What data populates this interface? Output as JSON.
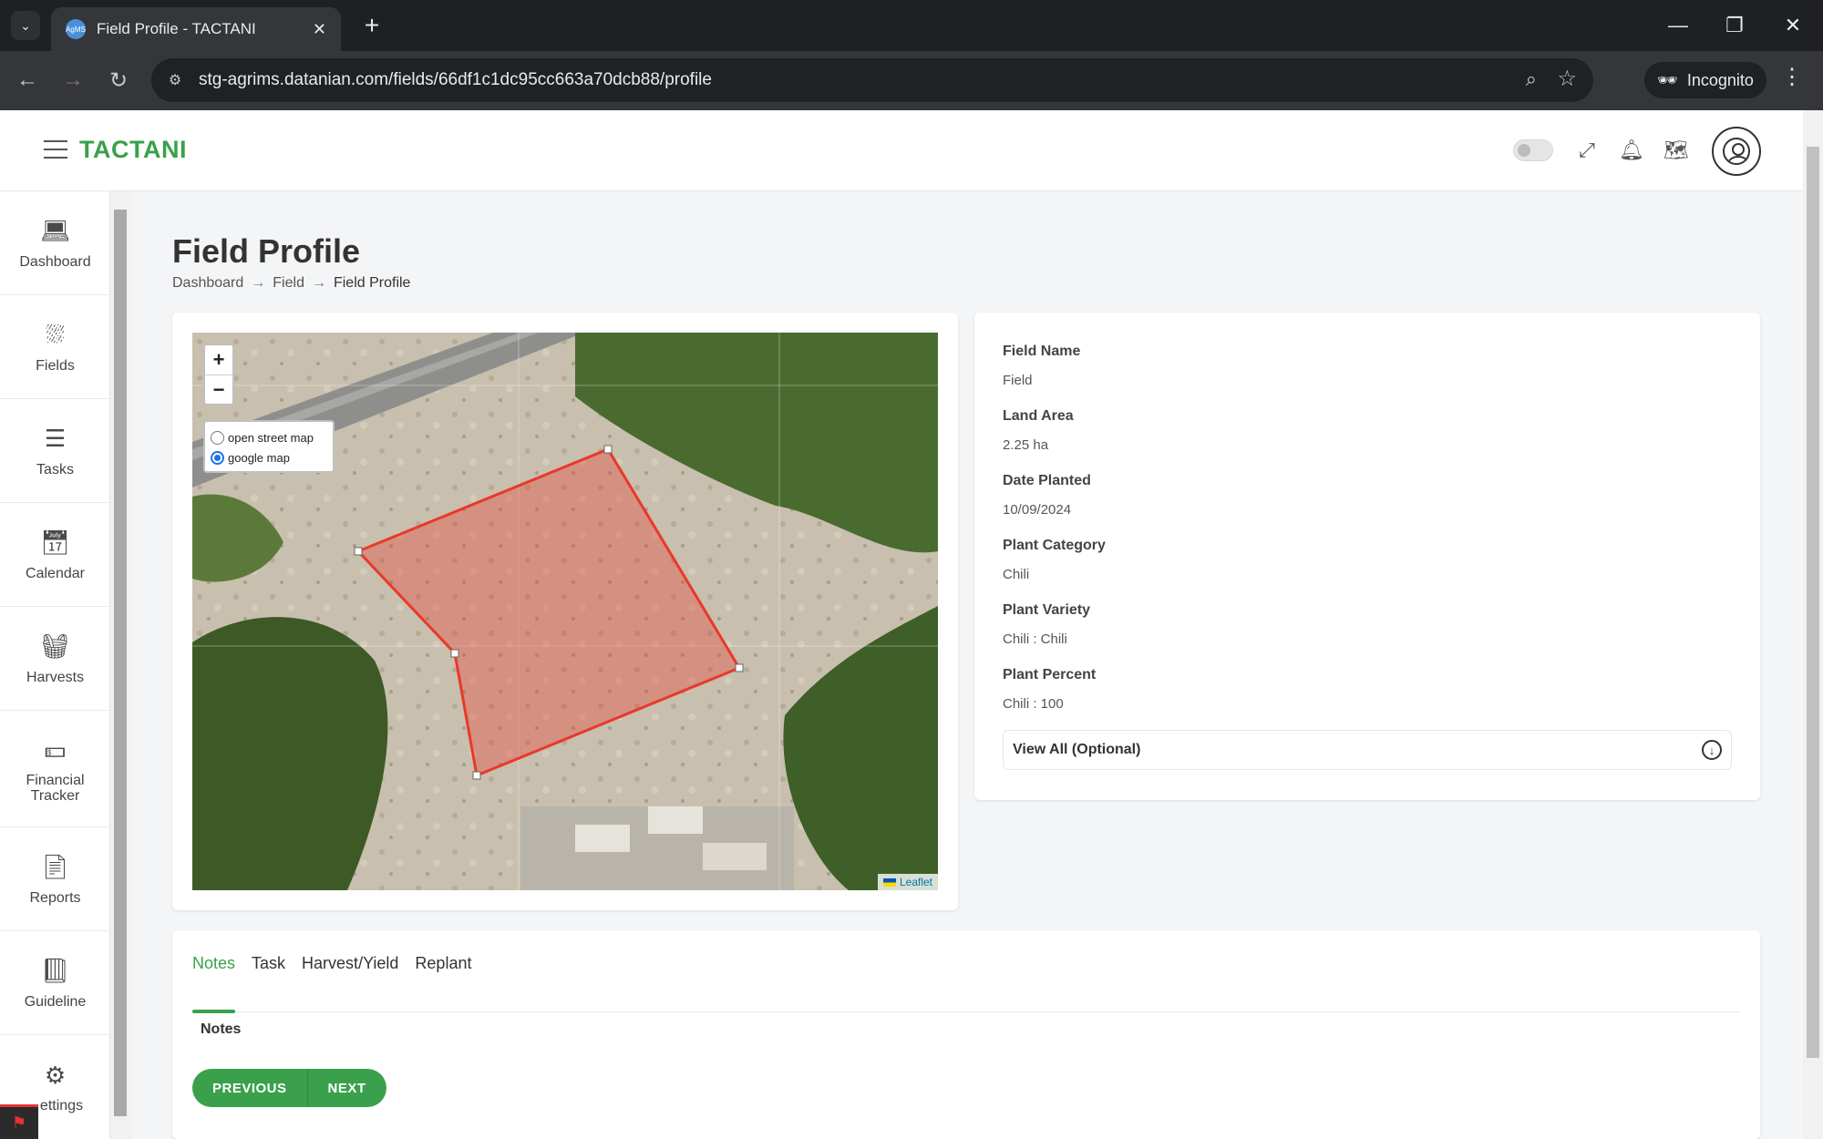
{
  "browser": {
    "tab_title": "Field Profile - TACTANI",
    "favicon_text": "AgMS",
    "url": "stg-agrims.datanian.com/fields/66df1c1dc95cc663a70dcb88/profile",
    "incognito_label": "Incognito"
  },
  "header": {
    "brand": "TACTANI"
  },
  "sidebar": {
    "items": [
      {
        "label": "Dashboard",
        "icon": "laptop-icon"
      },
      {
        "label": "Fields",
        "icon": "fields-icon"
      },
      {
        "label": "Tasks",
        "icon": "tasks-icon"
      },
      {
        "label": "Calendar",
        "icon": "calendar-icon"
      },
      {
        "label": "Harvests",
        "icon": "basket-icon"
      },
      {
        "label": "Financial Tracker",
        "icon": "money-icon"
      },
      {
        "label": "Reports",
        "icon": "report-icon"
      },
      {
        "label": "Guideline",
        "icon": "book-icon"
      },
      {
        "label": "ettings",
        "icon": "gear-icon"
      }
    ]
  },
  "page": {
    "title": "Field Profile",
    "breadcrumb": [
      "Dashboard",
      "Field",
      "Field Profile"
    ]
  },
  "map": {
    "zoom_in": "+",
    "zoom_out": "−",
    "layers": [
      "open street map",
      "google map"
    ],
    "selected_layer": "google map",
    "attribution": "Leaflet",
    "polygon_color": "#e8392a"
  },
  "field": {
    "name_label": "Field Name",
    "name": "Field",
    "area_label": "Land Area",
    "area": "2.25 ha",
    "date_label": "Date Planted",
    "date": "10/09/2024",
    "category_label": "Plant Category",
    "category": "Chili",
    "variety_label": "Plant Variety",
    "variety": "Chili : Chili",
    "percent_label": "Plant Percent",
    "percent": "Chili : 100",
    "view_all": "View All (Optional)"
  },
  "tabs": {
    "items": [
      "Notes",
      "Task",
      "Harvest/Yield",
      "Replant"
    ],
    "active": "Notes",
    "notes_label": "Notes",
    "previous": "PREVIOUS",
    "next": "NEXT"
  },
  "colors": {
    "brand": "#3aa04b",
    "accent": "#1a73e8"
  }
}
